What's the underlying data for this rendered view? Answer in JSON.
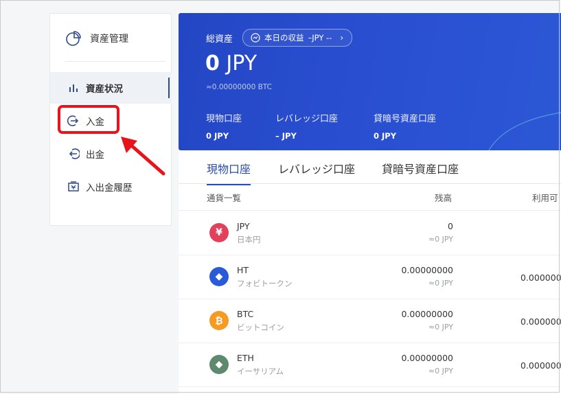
{
  "sidebar": {
    "header": "資産管理",
    "items": [
      {
        "label": "資産状況",
        "icon": "bar-chart-icon"
      },
      {
        "label": "入金",
        "icon": "deposit-icon"
      },
      {
        "label": "出金",
        "icon": "withdraw-icon"
      },
      {
        "label": "入出金履歴",
        "icon": "history-icon"
      }
    ]
  },
  "banner": {
    "total_label": "総資産",
    "today_profit": "本日の収益",
    "today_profit_value": "–JPY --",
    "total_value": "0",
    "total_unit": "JPY",
    "btc_equiv": "≈0.00000000 BTC",
    "accounts": [
      {
        "title": "現物口座",
        "value": "0 JPY"
      },
      {
        "title": "レバレッジ口座",
        "value": "– JPY"
      },
      {
        "title": "貸暗号資産口座",
        "value": "0 JPY"
      }
    ]
  },
  "tabs": [
    "現物口座",
    "レバレッジ口座",
    "貸暗号資産口座"
  ],
  "table": {
    "headers": [
      "通貨一覧",
      "残高",
      "利用可"
    ],
    "rows": [
      {
        "symbol": "JPY",
        "name": "日本円",
        "balance": "0",
        "balance_jpy": "≈0 JPY",
        "available": "",
        "color": "#e2405b",
        "glyph": "¥"
      },
      {
        "symbol": "HT",
        "name": "フォビトークン",
        "balance": "0.00000000",
        "balance_jpy": "≈0 JPY",
        "available": "0.000000",
        "color": "#2a5ad8",
        "glyph": "◆"
      },
      {
        "symbol": "BTC",
        "name": "ビットコイン",
        "balance": "0.00000000",
        "balance_jpy": "≈0 JPY",
        "available": "0.000000",
        "color": "#f59a23",
        "glyph": "₿"
      },
      {
        "symbol": "ETH",
        "name": "イーサリアム",
        "balance": "0.00000000",
        "balance_jpy": "≈0 JPY",
        "available": "0.000000",
        "color": "#5d8a6d",
        "glyph": "◆"
      }
    ]
  },
  "colors": {
    "accent": "#2a4da8",
    "banner": "#2346c4",
    "highlight": "#e8141b"
  }
}
